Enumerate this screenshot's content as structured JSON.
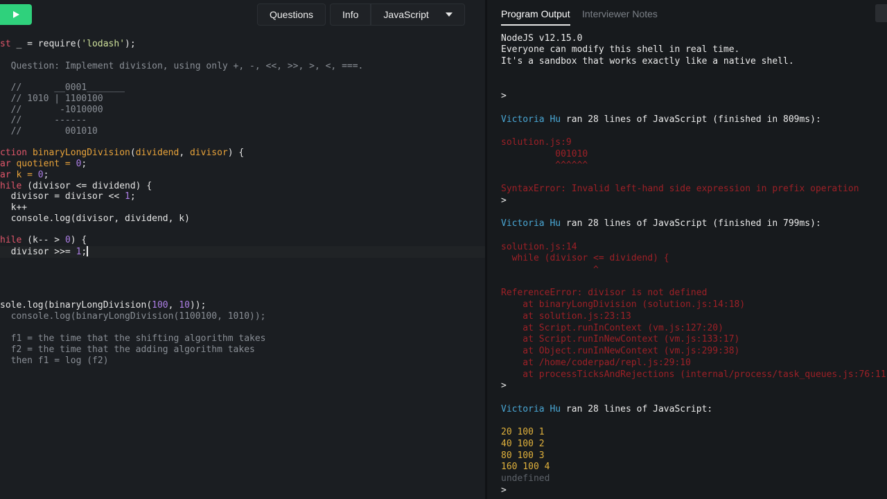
{
  "toolbar": {
    "questions_label": "Questions",
    "info_label": "Info",
    "language_label": "JavaScript"
  },
  "editor": {
    "line_1": [
      "st",
      " _ = require(",
      "'lodash'",
      ");"
    ],
    "line_2": "  Question: Implement division, using only +, -, <<, >>, >, <, ===.",
    "line_3": "  //      __0001_______",
    "line_4": "  // 1010 | 1100100",
    "line_5": "  //       -1010000",
    "line_6": "  //      ------",
    "line_7": "  //        001010",
    "line_8": [
      "ction ",
      "binaryLongDivision",
      "(",
      "dividend",
      ", ",
      "divisor",
      ") {"
    ],
    "line_9": [
      "ar ",
      "quotient = ",
      "0",
      ";"
    ],
    "line_10": [
      "ar ",
      "k = ",
      "0",
      ";"
    ],
    "line_11": [
      "hile ",
      "(divisor <= dividend) {"
    ],
    "line_12": [
      "  divisor = divisor << ",
      "1",
      ";"
    ],
    "line_13": "  k++",
    "line_14": "  console.log(divisor, dividend, k)",
    "line_15": [
      "hile ",
      "(k-- > ",
      "0",
      ") {"
    ],
    "line_16": [
      "  divisor >>= ",
      "1",
      ";"
    ],
    "line_17": [
      "sole.log(binaryLongDivision(",
      "100",
      ", ",
      "10",
      "));"
    ],
    "line_18": "  console.log(binaryLongDivision(1100100, 1010));",
    "line_19": "  f1 = the time that the shifting algorithm takes",
    "line_20": "  f2 = the time that the adding algorithm takes",
    "line_21": "  then f1 = log (f2)"
  },
  "panel": {
    "tab_output": "Program Output",
    "tab_notes": "Interviewer Notes"
  },
  "output": {
    "header_1": "NodeJS v12.15.0",
    "header_2": "Everyone can modify this shell in real time.",
    "header_3": "It's a sandbox that works exactly like a native shell.",
    "prompt": ">",
    "user": "Victoria Hu",
    "run_1": " ran 28 lines of JavaScript (finished in 809ms):",
    "err1_1": "solution.js:9",
    "err1_2": "          001010",
    "err1_3": "          ^^^^^^",
    "err1_4": "SyntaxError: Invalid left-hand side expression in prefix operation",
    "run_2": " ran 28 lines of JavaScript (finished in 799ms):",
    "err2_1": "solution.js:14",
    "err2_2": "  while (divisor <= dividend) {",
    "err2_3": "                 ^",
    "err2_4": "ReferenceError: divisor is not defined",
    "err2_5": "    at binaryLongDivision (solution.js:14:18)",
    "err2_6": "    at solution.js:23:13",
    "err2_7": "    at Script.runInContext (vm.js:127:20)",
    "err2_8": "    at Script.runInNewContext (vm.js:133:17)",
    "err2_9": "    at Object.runInNewContext (vm.js:299:38)",
    "err2_10": "    at /home/coderpad/repl.js:29:10",
    "err2_11": "    at processTicksAndRejections (internal/process/task_queues.js:76:11)",
    "run_3": " ran 28 lines of JavaScript:",
    "res_1": "20 100 1",
    "res_2": "40 100 2",
    "res_3": "80 100 3",
    "res_4": "160 100 4",
    "res_5": "undefined"
  },
  "colors": {
    "run_button": "#2fd17c",
    "keyword": "#e0566a",
    "function": "#e8a33a",
    "string": "#cfe29b",
    "number": "#ad7fe6",
    "comment": "#8a8f96",
    "error": "#d6232b",
    "user": "#4aa8d6",
    "result": "#e0b13c"
  }
}
